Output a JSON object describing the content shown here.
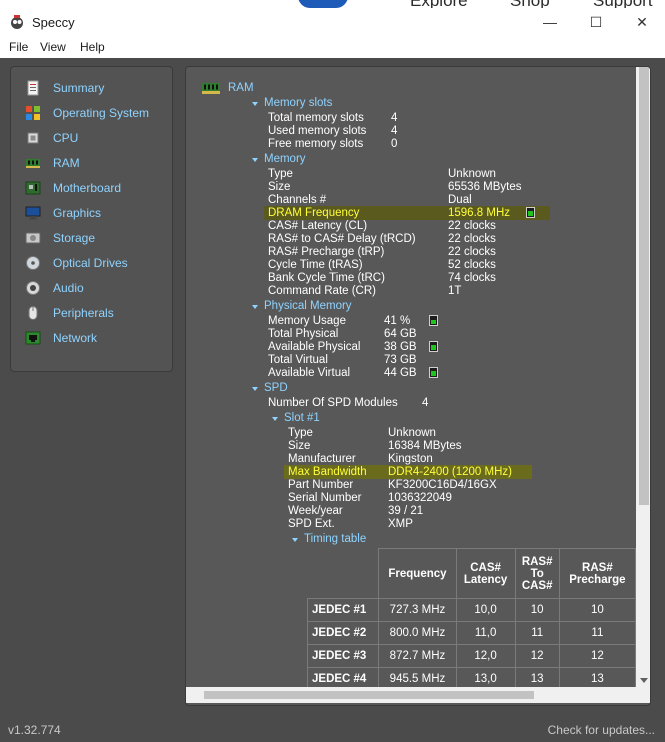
{
  "background": {
    "items": [
      "Explore",
      "Shop",
      "Support"
    ]
  },
  "window": {
    "title": "Speccy",
    "minimize_glyph": "—",
    "maximize_glyph": "☐",
    "close_glyph": "✕"
  },
  "menu": [
    "File",
    "View",
    "Help"
  ],
  "sidebar": {
    "items": [
      {
        "label": "Summary",
        "icon": "summary-icon"
      },
      {
        "label": "Operating System",
        "icon": "windows-icon"
      },
      {
        "label": "CPU",
        "icon": "cpu-icon"
      },
      {
        "label": "RAM",
        "icon": "ram-icon"
      },
      {
        "label": "Motherboard",
        "icon": "motherboard-icon"
      },
      {
        "label": "Graphics",
        "icon": "monitor-icon"
      },
      {
        "label": "Storage",
        "icon": "disk-icon"
      },
      {
        "label": "Optical Drives",
        "icon": "optical-disc-icon"
      },
      {
        "label": "Audio",
        "icon": "speaker-icon"
      },
      {
        "label": "Peripherals",
        "icon": "mouse-icon"
      },
      {
        "label": "Network",
        "icon": "network-icon"
      }
    ]
  },
  "ram": {
    "heading": "RAM",
    "memory_slots": {
      "heading": "Memory slots",
      "rows": [
        {
          "label": "Total memory slots",
          "value": "4"
        },
        {
          "label": "Used memory slots",
          "value": "4"
        },
        {
          "label": "Free memory slots",
          "value": "0"
        }
      ]
    },
    "memory": {
      "heading": "Memory",
      "rows": [
        {
          "label": "Type",
          "value": "Unknown"
        },
        {
          "label": "Size",
          "value": "65536 MBytes"
        },
        {
          "label": "Channels #",
          "value": "Dual"
        },
        {
          "label": "DRAM Frequency",
          "value": "1596.8 MHz"
        },
        {
          "label": "CAS# Latency (CL)",
          "value": "22 clocks"
        },
        {
          "label": "RAS# to CAS# Delay (tRCD)",
          "value": "22 clocks"
        },
        {
          "label": "RAS# Precharge (tRP)",
          "value": "22 clocks"
        },
        {
          "label": "Cycle Time (tRAS)",
          "value": "52 clocks"
        },
        {
          "label": "Bank Cycle Time (tRC)",
          "value": "74 clocks"
        },
        {
          "label": "Command Rate (CR)",
          "value": "1T"
        }
      ]
    },
    "physical_memory": {
      "heading": "Physical Memory",
      "rows": [
        {
          "label": "Memory Usage",
          "value": "41 %"
        },
        {
          "label": "Total Physical",
          "value": "64 GB"
        },
        {
          "label": "Available Physical",
          "value": "38 GB"
        },
        {
          "label": "Total Virtual",
          "value": "73 GB"
        },
        {
          "label": "Available Virtual",
          "value": "44 GB"
        }
      ]
    },
    "spd": {
      "heading": "SPD",
      "modules_label": "Number Of SPD Modules",
      "modules_value": "4",
      "slot": {
        "heading": "Slot #1",
        "rows": [
          {
            "label": "Type",
            "value": "Unknown"
          },
          {
            "label": "Size",
            "value": "16384 MBytes"
          },
          {
            "label": "Manufacturer",
            "value": "Kingston"
          },
          {
            "label": "Max Bandwidth",
            "value": "DDR4-2400 (1200 MHz)"
          },
          {
            "label": "Part Number",
            "value": "KF3200C16D4/16GX"
          },
          {
            "label": "Serial Number",
            "value": "1036322049"
          },
          {
            "label": "Week/year",
            "value": "39 / 21"
          },
          {
            "label": "SPD Ext.",
            "value": "XMP"
          }
        ]
      },
      "timing_table": {
        "heading": "Timing table",
        "headers": [
          "Frequency",
          "CAS# Latency",
          "RAS# To CAS#",
          "RAS# Precharge"
        ],
        "rows": [
          {
            "name": "JEDEC #1",
            "values": [
              "727.3 MHz",
              "10,0",
              "10",
              "10"
            ]
          },
          {
            "name": "JEDEC #2",
            "values": [
              "800.0 MHz",
              "11,0",
              "11",
              "11"
            ]
          },
          {
            "name": "JEDEC #3",
            "values": [
              "872.7 MHz",
              "12,0",
              "12",
              "12"
            ]
          },
          {
            "name": "JEDEC #4",
            "values": [
              "945.5 MHz",
              "13,0",
              "13",
              "13"
            ]
          }
        ]
      }
    }
  },
  "gauges": {
    "dram_frequency": 0.6,
    "memory_usage": 0.41,
    "available_physical": 0.59,
    "available_virtual": 0.6
  },
  "colors": {
    "section": "#8fd3ff",
    "highlight_text": "#ffff3a",
    "gauge": "#1fc41f"
  },
  "status": {
    "version": "v1.32.774",
    "update": "Check for updates..."
  }
}
